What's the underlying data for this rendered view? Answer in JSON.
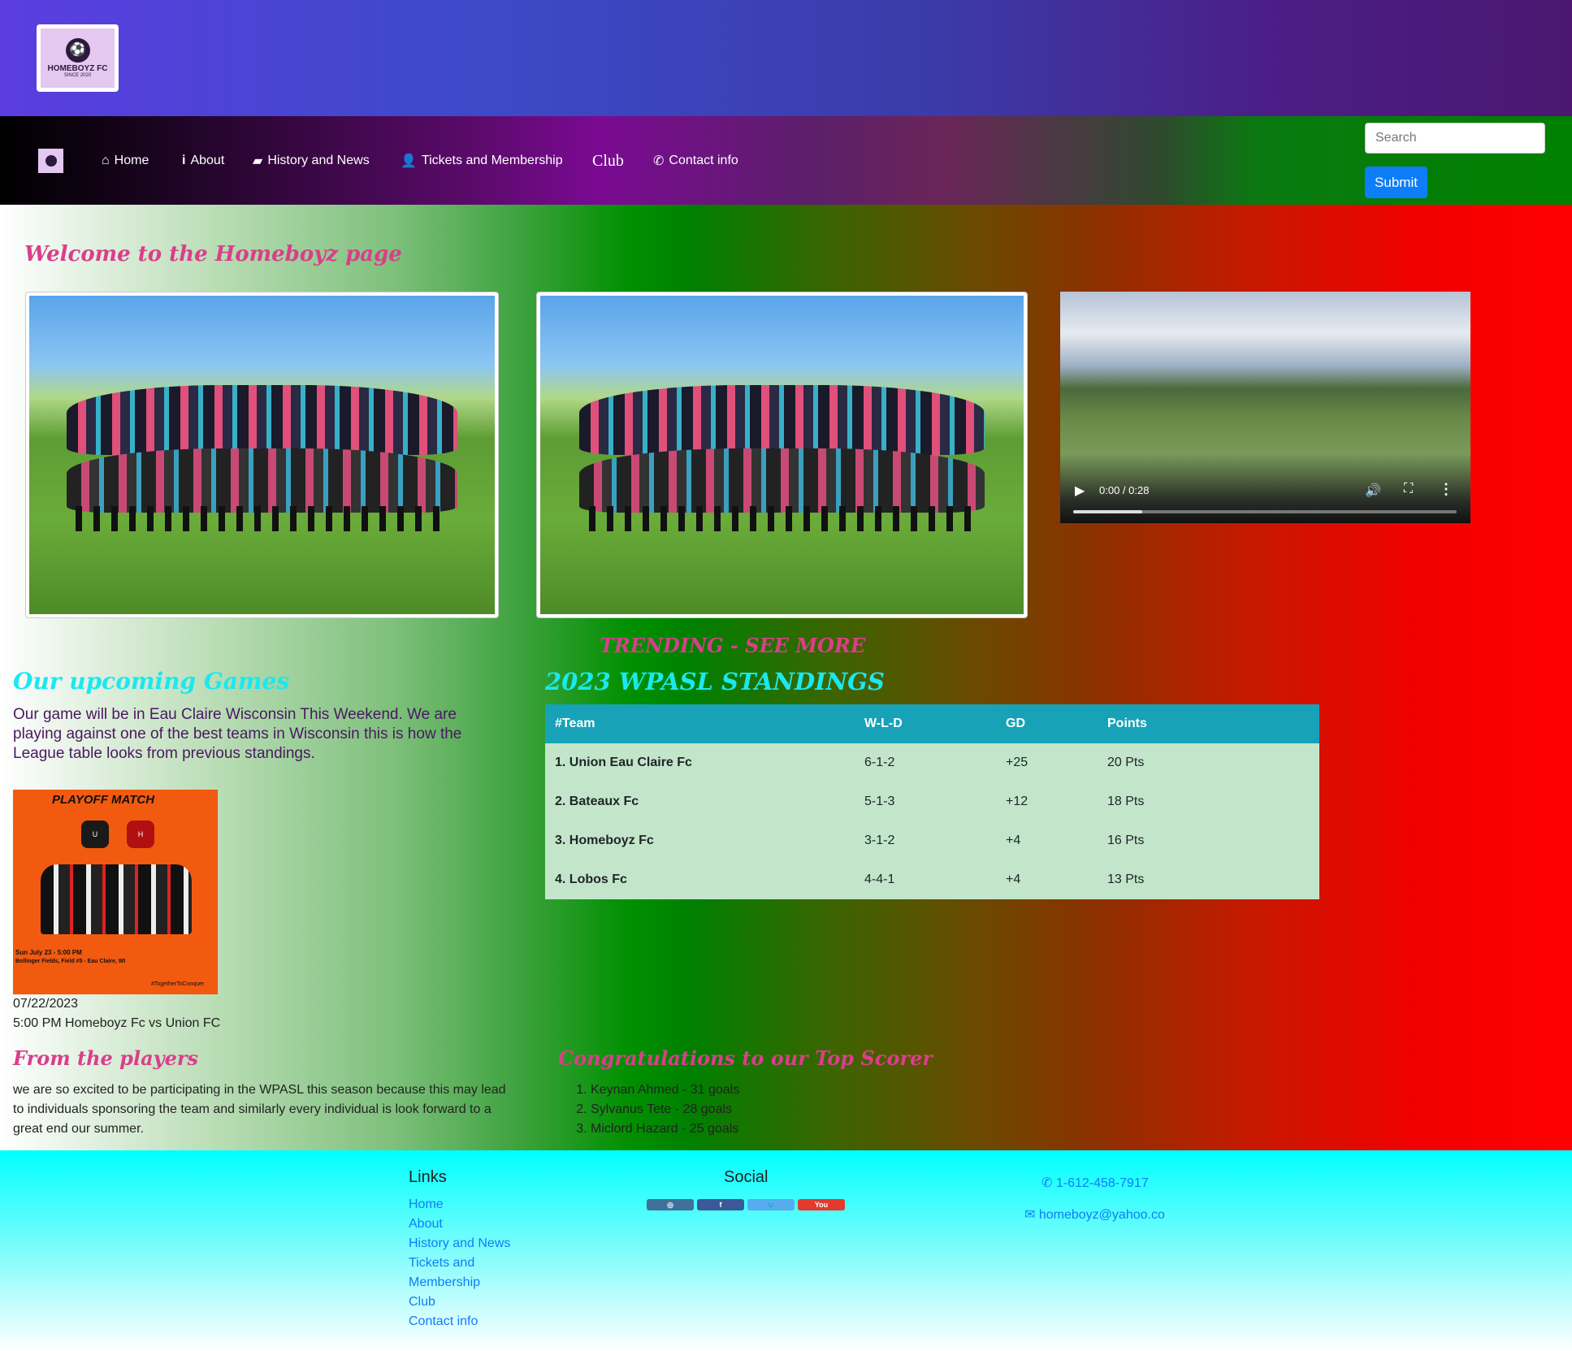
{
  "header": {
    "logo_title": "HOMEBOYZ FC",
    "logo_sub": "SINCE 2020"
  },
  "nav": {
    "items": [
      {
        "label": "Home",
        "icon": "home-icon"
      },
      {
        "label": "About",
        "icon": "info-icon"
      },
      {
        "label": "History and News",
        "icon": "book-icon"
      },
      {
        "label": "Tickets and Membership",
        "icon": "user-plus-icon"
      },
      {
        "label": "Club",
        "icon": ""
      },
      {
        "label": "Contact info",
        "icon": "phone-icon"
      }
    ],
    "search_placeholder": "Search",
    "submit_label": "Submit"
  },
  "main": {
    "welcome": "Welcome to the Homeboyz page",
    "video": {
      "time": "0:00 / 0:28",
      "progress": 0.18
    },
    "trending": "TRENDING - SEE MORE",
    "upcoming": {
      "title": "Our upcoming Games",
      "text": "Our game will be in Eau Claire Wisconsin This Weekend. We are playing against one of the best teams in Wisconsin this is how the League table looks from previous standings.",
      "poster_title": "PLAYOFF MATCH",
      "poster_date": "Sun July 23 - 5:00 PM",
      "poster_venue": "Bollinger Fields, Field #5 - Eau Claire, WI",
      "poster_tag": "#TogetherToConquer",
      "date": "07/22/2023",
      "desc": "5:00 PM Homeboyz Fc vs Union FC"
    },
    "standings": {
      "title": "2023 WPASL STANDINGS",
      "headers": [
        "#Team",
        "W-L-D",
        "GD",
        "Points"
      ],
      "rows": [
        [
          "1. Union Eau Claire Fc",
          "6-1-2",
          "+25",
          "20 Pts"
        ],
        [
          "2. Bateaux Fc",
          "5-1-3",
          "+12",
          "18 Pts"
        ],
        [
          "3. Homeboyz Fc",
          "3-1-2",
          "+4",
          "16 Pts"
        ],
        [
          "4. Lobos Fc",
          "4-4-1",
          "+4",
          "13 Pts"
        ]
      ]
    },
    "players": {
      "title": "From the players",
      "text": "we are so excited to be participating in the WPASL this season because this may lead to individuals sponsoring the team and similarly every individual is look forward to a great end our summer."
    },
    "scorers": {
      "title": "Congratulations to our Top Scorer",
      "list": [
        "Keynan Ahmed - 31 goals",
        "Sylvanus Tete - 28 goals",
        "Miclord Hazard - 25 goals"
      ]
    }
  },
  "footer": {
    "links_heading": "Links",
    "links": [
      "Home",
      "About",
      "History and News",
      "Tickets and Membership",
      "Club",
      "Contact info"
    ],
    "social_heading": "Social",
    "social": [
      {
        "name": "instagram",
        "label": "",
        "color": "#3f729b"
      },
      {
        "name": "facebook",
        "label": "f",
        "color": "#3b5998"
      },
      {
        "name": "twitter",
        "label": "",
        "color": "#55acee"
      },
      {
        "name": "youtube",
        "label": "You",
        "color": "#e33a2d"
      }
    ],
    "phone": "1-612-458-7917",
    "email": "homeboyz@yahoo.co"
  }
}
